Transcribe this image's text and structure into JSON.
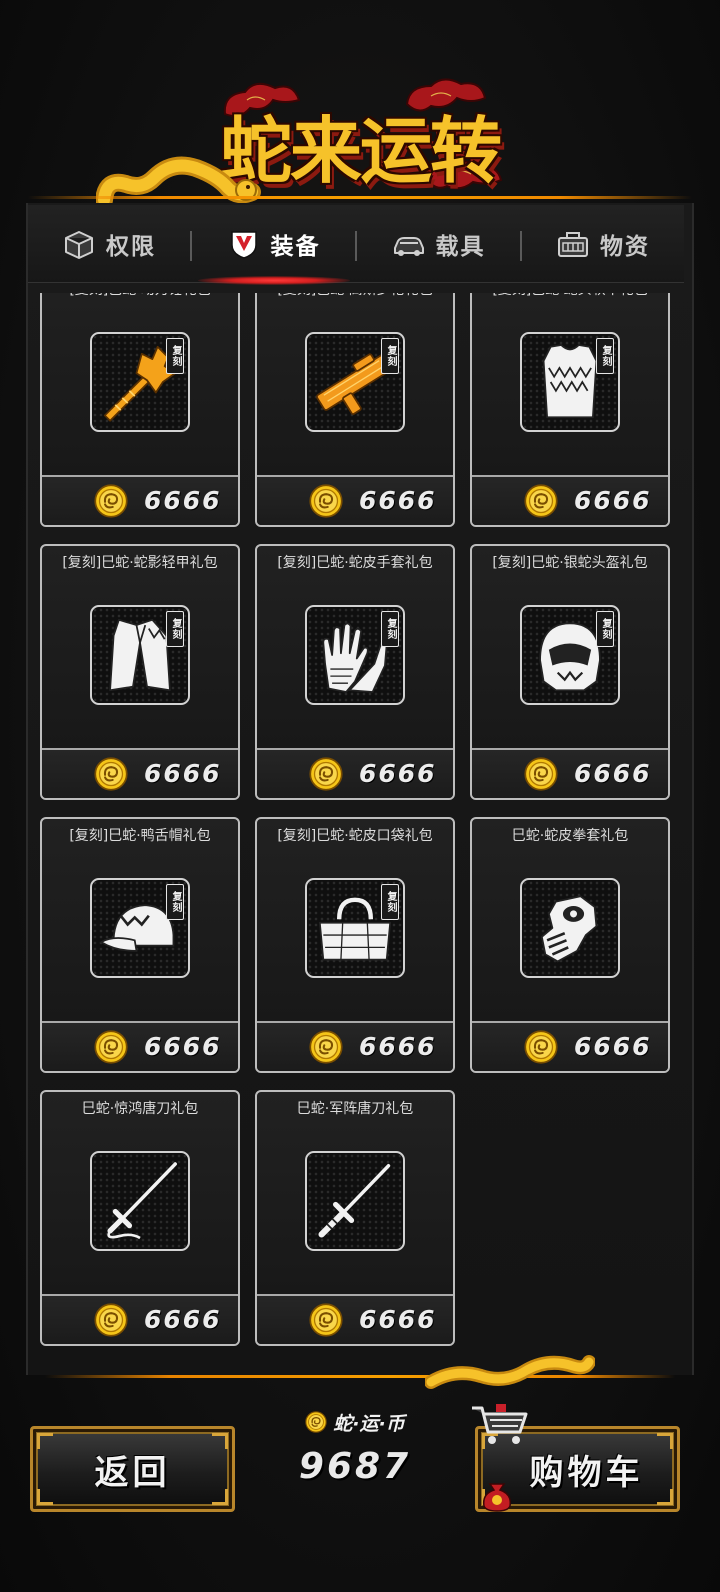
{
  "header": {
    "title": "蛇来运转"
  },
  "tabs": [
    {
      "label": "权限",
      "icon": "box-icon",
      "active": false
    },
    {
      "label": "装备",
      "icon": "shield-icon",
      "active": true
    },
    {
      "label": "载具",
      "icon": "car-icon",
      "active": false
    },
    {
      "label": "物资",
      "icon": "crate-icon",
      "active": false
    }
  ],
  "items": [
    {
      "title": "[复刻]巳蛇·动力锤礼包",
      "badge": "复刻",
      "icon": "mace-icon",
      "price": "6666"
    },
    {
      "title": "[复刻]巳蛇·高斯步枪礼包",
      "badge": "复刻",
      "icon": "rifle-icon",
      "price": "6666"
    },
    {
      "title": "[复刻]巳蛇·蛇头软甲礼包",
      "badge": "复刻",
      "icon": "vest-icon",
      "price": "6666"
    },
    {
      "title": "[复刻]巳蛇·蛇影轻甲礼包",
      "badge": "复刻",
      "icon": "jacket-icon",
      "price": "6666"
    },
    {
      "title": "[复刻]巳蛇·蛇皮手套礼包",
      "badge": "复刻",
      "icon": "gloves-icon",
      "price": "6666"
    },
    {
      "title": "[复刻]巳蛇·银蛇头盔礼包",
      "badge": "复刻",
      "icon": "helmet-icon",
      "price": "6666"
    },
    {
      "title": "[复刻]巳蛇·鸭舌帽礼包",
      "badge": "复刻",
      "icon": "cap-icon",
      "price": "6666"
    },
    {
      "title": "[复刻]巳蛇·蛇皮口袋礼包",
      "badge": "复刻",
      "icon": "bag-icon",
      "price": "6666"
    },
    {
      "title": "巳蛇·蛇皮拳套礼包",
      "badge": "",
      "icon": "fist-icon",
      "price": "6666"
    },
    {
      "title": "巳蛇·惊鸿唐刀礼包",
      "badge": "",
      "icon": "sword-icon",
      "price": "6666"
    },
    {
      "title": "巳蛇·军阵唐刀礼包",
      "badge": "",
      "icon": "sword-icon",
      "price": "6666"
    }
  ],
  "footer": {
    "back_label": "返回",
    "currency_icon": "snake-coin-icon",
    "currency_label": "蛇·运·币",
    "currency_value": "9687",
    "cart_label": "购物车",
    "cart_icon": "cart-icon"
  },
  "colors": {
    "gold": "#f6c22a",
    "accent_line": "#f08a00",
    "active_tab": "#e2262b",
    "card_border": "#bdbdbd",
    "panel": "#161616"
  }
}
